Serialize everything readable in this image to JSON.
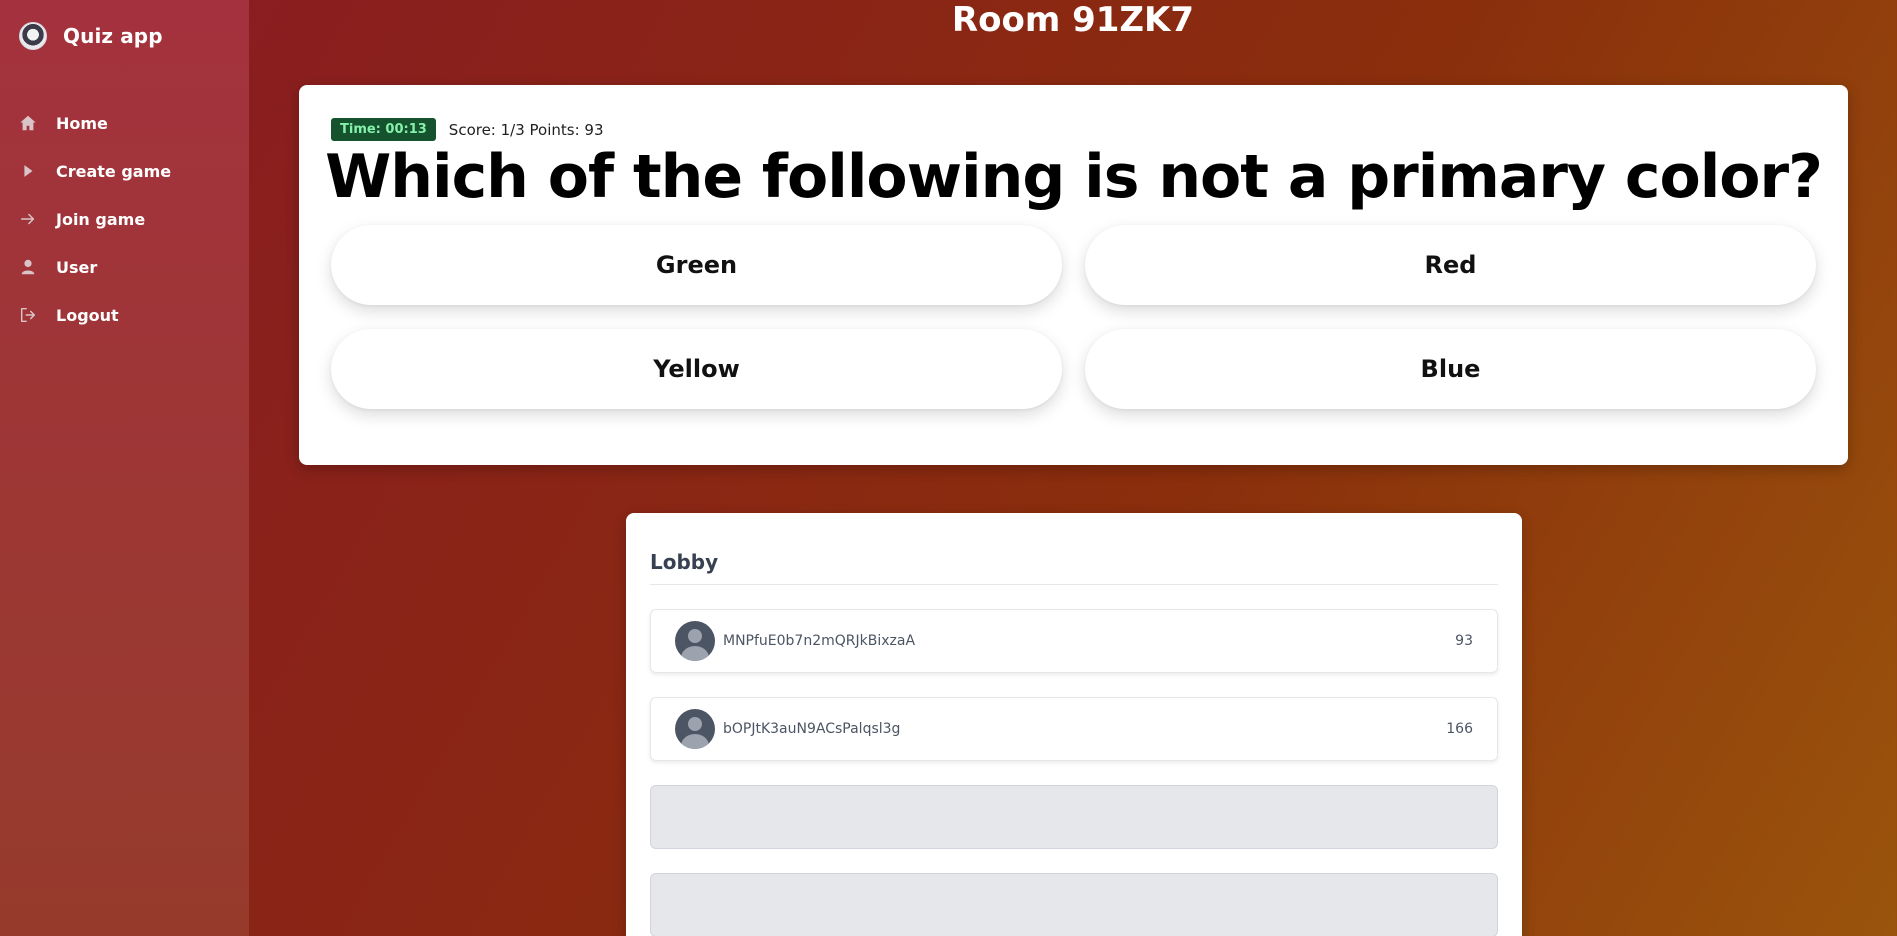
{
  "app": {
    "name": "Quiz app",
    "logo_icon": "quiz-app-logo-icon"
  },
  "sidebar": {
    "items": [
      {
        "label": "Home",
        "icon": "home-icon"
      },
      {
        "label": "Create game",
        "icon": "play-icon"
      },
      {
        "label": "Join game",
        "icon": "arrow-right-icon"
      },
      {
        "label": "User",
        "icon": "user-icon"
      },
      {
        "label": "Logout",
        "icon": "logout-icon"
      }
    ]
  },
  "room": {
    "title": "Room 91ZK7"
  },
  "quiz": {
    "timer": "Time: 00:13",
    "score": "Score: 1/3 Points: 93",
    "question": "Which of the following is not a primary color?",
    "answers": [
      "Green",
      "Red",
      "Yellow",
      "Blue"
    ]
  },
  "lobby": {
    "title": "Lobby",
    "players": [
      {
        "name": "MNPfuE0b7n2mQRJkBixzaA",
        "points": "93"
      },
      {
        "name": "bOPJtK3auN9ACsPalqsl3g",
        "points": "166"
      }
    ],
    "empty_slots": 2
  },
  "colors": {
    "timer_bg": "#14532d",
    "timer_text": "#86efac",
    "sidebar_bg": "#a4323e",
    "background_start": "#8a1a24",
    "background_end": "#9a540c"
  }
}
